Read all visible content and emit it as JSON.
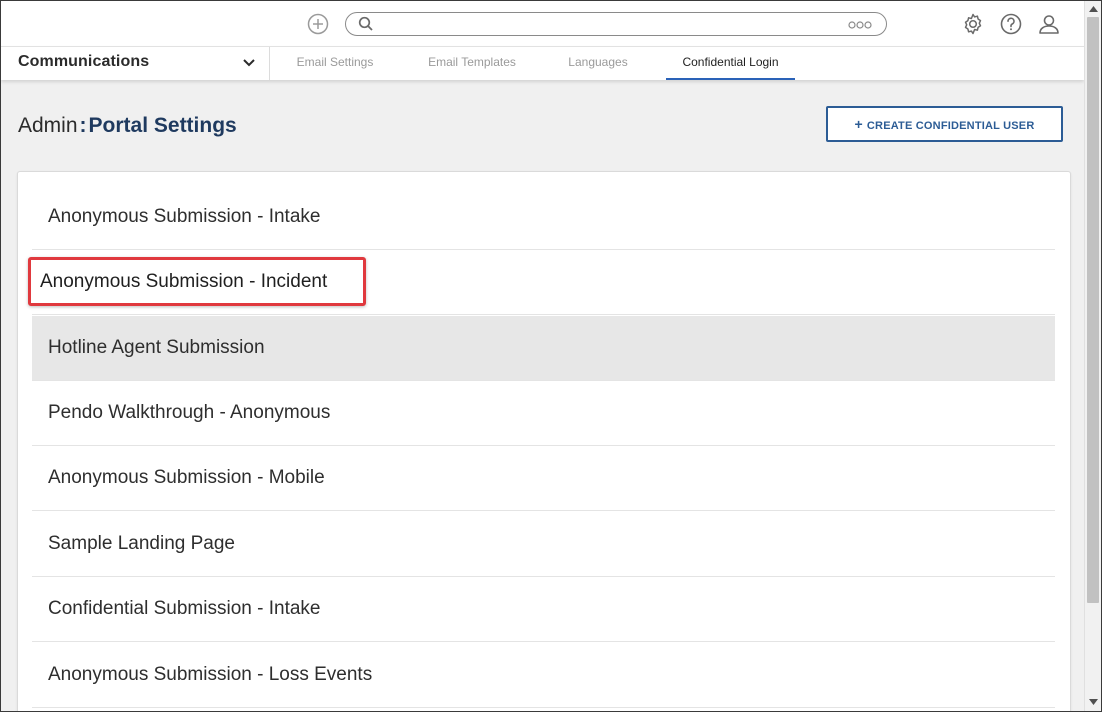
{
  "topbar": {
    "add_icon": "plus-circle-icon",
    "search": {
      "placeholder": "",
      "value": ""
    },
    "icons": [
      "gear-icon",
      "help-icon",
      "user-icon"
    ]
  },
  "nav": {
    "module": "Communications",
    "tabs": [
      {
        "label": "Email Settings"
      },
      {
        "label": "Email Templates"
      },
      {
        "label": "Languages"
      },
      {
        "label": "Confidential Login",
        "active": true
      }
    ]
  },
  "header": {
    "title_prefix": "Admin",
    "title_separator": ":",
    "title_main": "Portal Settings",
    "create_button": "CREATE CONFIDENTIAL USER"
  },
  "list": {
    "items": [
      "Anonymous Submission - Intake",
      "Anonymous Submission - Incident",
      "Hotline Agent Submission",
      "Pendo Walkthrough - Anonymous",
      "Anonymous Submission - Mobile",
      "Sample Landing Page",
      "Confidential Submission - Intake",
      "Anonymous Submission - Loss Events"
    ],
    "highlighted_index": 1,
    "hovered_index": 2
  },
  "colors": {
    "accent": "#2a62b8",
    "title": "#1f3a5f",
    "button": "#2c5c95",
    "highlight_border": "#e0393e",
    "hover_row": "#e7e7e7"
  }
}
